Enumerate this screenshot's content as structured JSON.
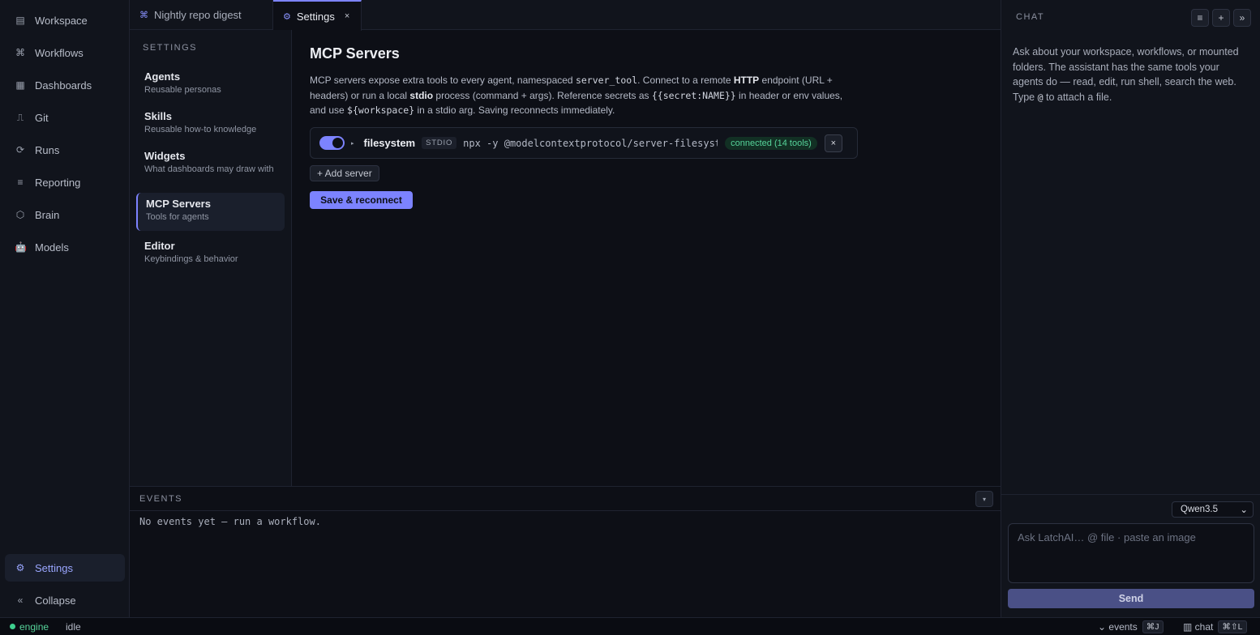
{
  "nav": {
    "items": [
      {
        "icon": "▤",
        "label": "Workspace"
      },
      {
        "icon": "⌘",
        "label": "Workflows"
      },
      {
        "icon": "▦",
        "label": "Dashboards"
      },
      {
        "icon": "⎍",
        "label": "Git"
      },
      {
        "icon": "⟳",
        "label": "Runs"
      },
      {
        "icon": "≡",
        "label": "Reporting"
      },
      {
        "icon": "⬡",
        "label": "Brain"
      },
      {
        "icon": "🤖",
        "label": "Models"
      }
    ],
    "settings": {
      "icon": "⚙",
      "label": "Settings"
    },
    "collapse": {
      "icon": "«",
      "label": "Collapse"
    }
  },
  "tabs": [
    {
      "icon": "⌘",
      "label": "Nightly repo digest"
    },
    {
      "icon": "⚙",
      "label": "Settings",
      "close": "×"
    }
  ],
  "settings_nav": {
    "heading": "SETTINGS",
    "items": [
      {
        "title": "Agents",
        "desc": "Reusable personas"
      },
      {
        "title": "Skills",
        "desc": "Reusable how-to knowledge"
      },
      {
        "title": "Widgets",
        "desc": "What dashboards may draw with"
      },
      {
        "title": "MCP Servers",
        "desc": "Tools for agents"
      },
      {
        "title": "Editor",
        "desc": "Keybindings & behavior"
      }
    ]
  },
  "main": {
    "title": "MCP Servers",
    "desc": {
      "p1": "MCP servers expose extra tools to every agent, namespaced ",
      "c1": "server_tool",
      "p2": ". Connect to a remote ",
      "b1": "HTTP",
      "p3": " endpoint (URL + headers) or run a local ",
      "b2": "stdio",
      "p4": " process (command + args). Reference secrets as ",
      "c2": "{{secret:NAME}}",
      "p5": " in header or env values, and use ",
      "c3": "${workspace}",
      "p6": " in a stdio arg. Saving reconnects immediately."
    },
    "server": {
      "enabled": true,
      "caret": "▸",
      "name": "filesystem",
      "transport": "STDIO",
      "command": "npx -y @modelcontextprotocol/server-filesyst…",
      "status": "connected (14 tools)",
      "remove": "×"
    },
    "add_label": "+ Add server",
    "save_label": "Save & reconnect"
  },
  "events": {
    "heading": "EVENTS",
    "toggle": "▾",
    "empty": "No events yet — run a workflow."
  },
  "chat": {
    "heading": "CHAT",
    "buttons": [
      "≡",
      "+",
      "»"
    ],
    "intro": {
      "p1": "Ask about your workspace, workflows, or mounted folders. The assistant has the same tools your agents do — read, edit, run shell, search the web. Type ",
      "c1": "@",
      "p2": " to attach a file."
    },
    "model": "Qwen3.5",
    "model_caret": "⌄",
    "placeholder": "Ask LatchAI…  @ file · paste an image",
    "send": "Send"
  },
  "statusbar": {
    "engine": "engine",
    "state": "idle",
    "events_label": "⌄ events",
    "events_kbd": "⌘J",
    "chat_label": "▥ chat",
    "chat_kbd": "⌘⇧L"
  }
}
